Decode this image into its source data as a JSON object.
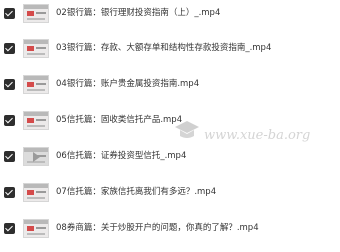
{
  "files": [
    {
      "label": "02银行篇：银行理财投资指南（上）_.mp4"
    },
    {
      "label": "03银行篇：存款、大额存单和结构性存款投资指南_.mp4"
    },
    {
      "label": "04银行篇：账户贵金属投资指南.mp4"
    },
    {
      "label": "05信托篇：固收类信托产品.mp4"
    },
    {
      "label": "06信托篇：证券投资型信托_.mp4"
    },
    {
      "label": "07信托篇：家族信托离我们有多远？.mp4"
    },
    {
      "label": "08券商篇：关于炒股开户的问题，你真的了解？.mp4"
    }
  ],
  "watermark": {
    "text": "www.xue-ba.org"
  }
}
